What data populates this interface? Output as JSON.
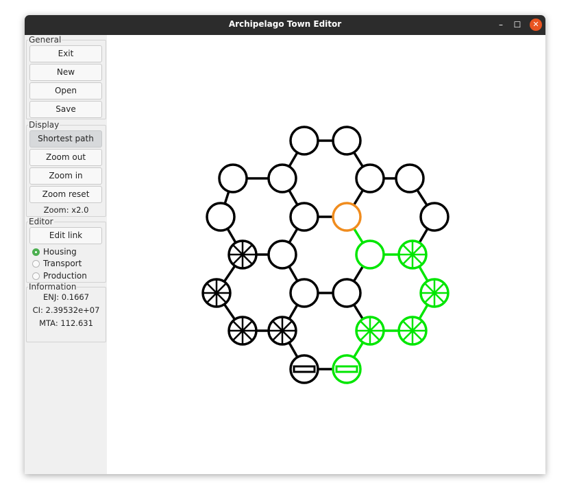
{
  "window": {
    "title": "Archipelago Town Editor",
    "minimize_icon": "–",
    "maximize_icon": "☐",
    "close_icon": "✕"
  },
  "sidebar": {
    "general": {
      "label": "General",
      "buttons": [
        "Exit",
        "New",
        "Open",
        "Save"
      ]
    },
    "display": {
      "label": "Display",
      "buttons": [
        "Shortest path",
        "Zoom out",
        "Zoom in",
        "Zoom reset"
      ],
      "zoom_text": "Zoom: x2.0",
      "active_button": "Shortest path"
    },
    "editor": {
      "label": "Editor",
      "edit_link": "Edit link",
      "radio_options": [
        "Housing",
        "Transport",
        "Production"
      ],
      "selected": "Housing"
    },
    "information": {
      "label": "Information",
      "enj": "ENJ: 0.1667",
      "ci": "CI: 2.39532e+07",
      "mta": "MTA: 112.631"
    }
  },
  "colors": {
    "normal": "#000000",
    "path": "#00e600",
    "selected": "#f08c1e",
    "close_button": "#e95420",
    "radio_on": "#4caf50"
  },
  "graph": {
    "nodes": [
      {
        "id": "n1",
        "type": "plain",
        "color": "normal"
      },
      {
        "id": "n2",
        "type": "plain",
        "color": "normal"
      },
      {
        "id": "n3",
        "type": "plain",
        "color": "normal"
      },
      {
        "id": "n4",
        "type": "plain",
        "color": "normal"
      },
      {
        "id": "n5",
        "type": "plain",
        "color": "normal"
      },
      {
        "id": "n6",
        "type": "plain",
        "color": "normal"
      },
      {
        "id": "n7",
        "type": "plain",
        "color": "normal"
      },
      {
        "id": "n8",
        "type": "plain",
        "color": "normal"
      },
      {
        "id": "n9",
        "type": "plain",
        "color": "selected"
      },
      {
        "id": "n10",
        "type": "plain",
        "color": "normal"
      },
      {
        "id": "n11",
        "type": "star",
        "color": "normal"
      },
      {
        "id": "n12",
        "type": "plain",
        "color": "normal"
      },
      {
        "id": "n13",
        "type": "plain",
        "color": "path"
      },
      {
        "id": "n14",
        "type": "star",
        "color": "path"
      },
      {
        "id": "n15",
        "type": "star",
        "color": "normal"
      },
      {
        "id": "n16",
        "type": "plain",
        "color": "normal"
      },
      {
        "id": "n17",
        "type": "plain",
        "color": "normal"
      },
      {
        "id": "n18",
        "type": "star",
        "color": "path"
      },
      {
        "id": "n19",
        "type": "star",
        "color": "normal"
      },
      {
        "id": "n20",
        "type": "star",
        "color": "normal"
      },
      {
        "id": "n21",
        "type": "star",
        "color": "path"
      },
      {
        "id": "n22",
        "type": "star",
        "color": "path"
      },
      {
        "id": "n23",
        "type": "bar",
        "color": "normal"
      },
      {
        "id": "n24",
        "type": "bar",
        "color": "path"
      }
    ],
    "links": [
      {
        "from": "n1",
        "to": "n2",
        "color": "normal"
      },
      {
        "from": "n1",
        "to": "n4",
        "color": "normal"
      },
      {
        "from": "n2",
        "to": "n5",
        "color": "normal"
      },
      {
        "from": "n3",
        "to": "n4",
        "color": "normal"
      },
      {
        "from": "n3",
        "to": "n7",
        "color": "normal"
      },
      {
        "from": "n4",
        "to": "n8",
        "color": "normal"
      },
      {
        "from": "n5",
        "to": "n6",
        "color": "normal"
      },
      {
        "from": "n5",
        "to": "n9",
        "color": "normal"
      },
      {
        "from": "n6",
        "to": "n10",
        "color": "normal"
      },
      {
        "from": "n7",
        "to": "n11",
        "color": "normal"
      },
      {
        "from": "n8",
        "to": "n9",
        "color": "normal"
      },
      {
        "from": "n8",
        "to": "n12",
        "color": "normal"
      },
      {
        "from": "n9",
        "to": "n13",
        "color": "path"
      },
      {
        "from": "n10",
        "to": "n14",
        "color": "normal"
      },
      {
        "from": "n11",
        "to": "n12",
        "color": "normal"
      },
      {
        "from": "n11",
        "to": "n15",
        "color": "normal"
      },
      {
        "from": "n12",
        "to": "n16",
        "color": "normal"
      },
      {
        "from": "n13",
        "to": "n14",
        "color": "path"
      },
      {
        "from": "n13",
        "to": "n17",
        "color": "normal"
      },
      {
        "from": "n14",
        "to": "n18",
        "color": "path"
      },
      {
        "from": "n15",
        "to": "n19",
        "color": "normal"
      },
      {
        "from": "n16",
        "to": "n17",
        "color": "normal"
      },
      {
        "from": "n16",
        "to": "n20",
        "color": "normal"
      },
      {
        "from": "n17",
        "to": "n21",
        "color": "normal"
      },
      {
        "from": "n18",
        "to": "n22",
        "color": "path"
      },
      {
        "from": "n19",
        "to": "n20",
        "color": "normal"
      },
      {
        "from": "n20",
        "to": "n23",
        "color": "normal"
      },
      {
        "from": "n21",
        "to": "n22",
        "color": "path"
      },
      {
        "from": "n21",
        "to": "n24",
        "color": "path"
      },
      {
        "from": "n23",
        "to": "n24",
        "color": "normal"
      }
    ]
  }
}
